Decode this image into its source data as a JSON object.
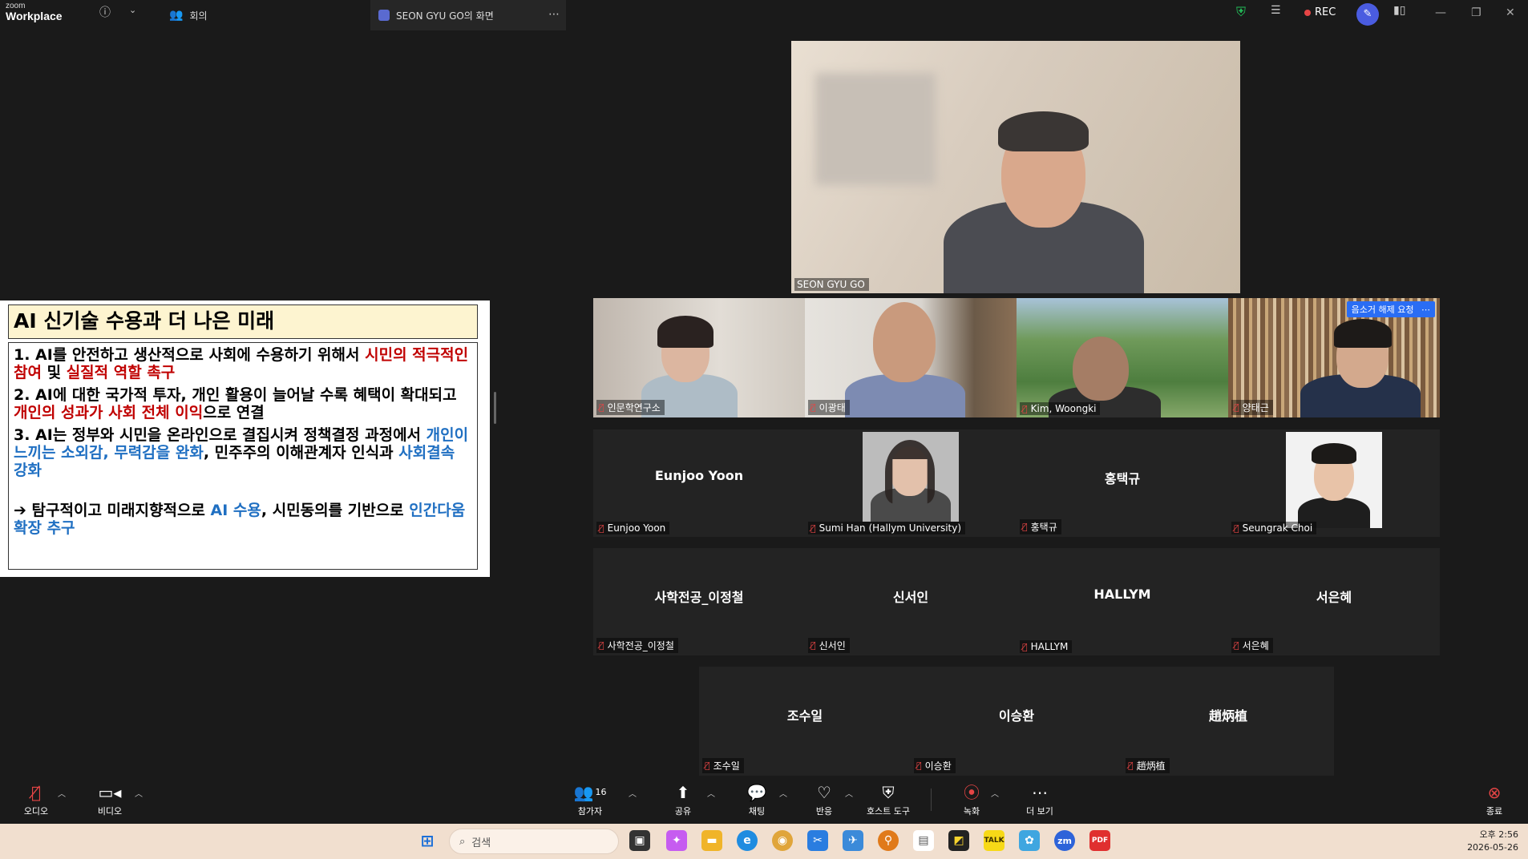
{
  "titlebar": {
    "logo_line1": "zoom",
    "logo_line2": "Workplace",
    "tab_meetings": "회의",
    "tab_share": "SEON GYU GO의 화면",
    "rec_label": "REC"
  },
  "slide": {
    "title": "AI 신기술 수용과 더 나은 미래",
    "p1a": "1. AI를 안전하고 생산적으로 사회에 수용하기 위해서 ",
    "p1b": "시민의 적극적인 참여",
    "p1c": " 및 ",
    "p1d": "실질적 역할 촉구",
    "p2a": "2. AI에 대한 국가적 투자, 개인 활용이 늘어날 수록 혜택이 확대되고 ",
    "p2b": "개인의 성과가 사회 전체 이익",
    "p2c": "으로 연결",
    "p3a": "3. AI는 정부와 시민을 온라인으로 결집시켜 정책결정 과정에서 ",
    "p3b": "개인이 느끼는 소외감, 무력감을 완화",
    "p3c": ", 민주주의 이해관계자 인식과 ",
    "p3d": "사회결속 강화",
    "p4a": "➔ 탐구적이고 미래지향적으로 ",
    "p4b": "AI 수용",
    "p4c": ", 시민동의를 기반으로 ",
    "p4d": "인간다움 확장 추구"
  },
  "speaker": {
    "name": "SEON GYU GO"
  },
  "participants_row1": [
    {
      "name": "인문학연구소"
    },
    {
      "name": "이광태"
    },
    {
      "name": "Kim, Woongki"
    },
    {
      "name": "양태근"
    }
  ],
  "unmute_request": "음소거 해제 요청",
  "participants_row2": [
    {
      "center": "Eunjoo Yoon",
      "name": "Eunjoo Yoon"
    },
    {
      "center": "",
      "name": "Sumi Han (Hallym University)"
    },
    {
      "center": "홍택규",
      "name": "홍택규"
    },
    {
      "center": "",
      "name": "Seungrak Choi"
    }
  ],
  "participants_row3": [
    {
      "center": "사학전공_이정철",
      "name": "사학전공_이정철"
    },
    {
      "center": "신서인",
      "name": "신서인"
    },
    {
      "center": "HALLYM",
      "name": "HALLYM"
    },
    {
      "center": "서은혜",
      "name": "서은혜"
    }
  ],
  "participants_row4": [
    {
      "center": "조수일",
      "name": "조수일"
    },
    {
      "center": "이승환",
      "name": "이승환"
    },
    {
      "center": "趙炳植",
      "name": "趙炳植"
    }
  ],
  "toolbar": {
    "audio": "오디오",
    "video": "비디오",
    "participants": "참가자",
    "participants_count": "16",
    "share": "공유",
    "chat": "채팅",
    "reactions": "반응",
    "host_tools": "호스트 도구",
    "record": "녹화",
    "more": "더 보기",
    "end": "종료"
  },
  "taskbar": {
    "search_placeholder": "검색",
    "time": "오후 2:56",
    "date": "2026-05-26"
  },
  "colors": {
    "accent_red": "#e64545",
    "accent_blue": "#2a6df4",
    "slide_red": "#c00000",
    "slide_blue": "#1f6fc2"
  }
}
